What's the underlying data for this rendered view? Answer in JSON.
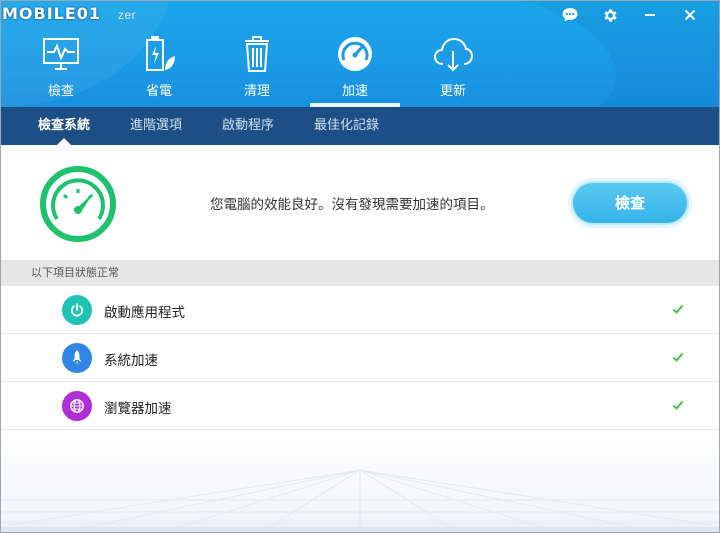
{
  "window": {
    "title": "zer",
    "watermark": "MOBILE01",
    "controls": [
      "feedback-icon",
      "gear-icon",
      "minimize-icon",
      "close-icon"
    ]
  },
  "main_nav": {
    "items": [
      {
        "label": "檢查",
        "icon": "monitor-pulse-icon",
        "active": false
      },
      {
        "label": "省電",
        "icon": "battery-leaf-icon",
        "active": false
      },
      {
        "label": "清理",
        "icon": "trash-can-icon",
        "active": false
      },
      {
        "label": "加速",
        "icon": "speedometer-icon",
        "active": true
      },
      {
        "label": "更新",
        "icon": "cloud-download-icon",
        "active": false
      }
    ]
  },
  "sub_nav": {
    "tabs": [
      {
        "label": "檢查系統",
        "active": true
      },
      {
        "label": "進階選項",
        "active": false
      },
      {
        "label": "啟動程序",
        "active": false
      },
      {
        "label": "最佳化記錄",
        "active": false
      }
    ]
  },
  "status": {
    "message": "您電腦的效能良好。沒有發現需要加速的項目。",
    "scan_button": "檢查",
    "gauge_icon": "speedometer-icon",
    "gauge_color": "#1fc26c"
  },
  "section": {
    "header": "以下項目狀態正常"
  },
  "items": [
    {
      "label": "啟動應用程式",
      "icon": "power-icon",
      "color": "#1dc4b4",
      "status": "ok"
    },
    {
      "label": "系統加速",
      "icon": "rocket-icon",
      "color": "#2f86e6",
      "status": "ok"
    },
    {
      "label": "瀏覽器加速",
      "icon": "globe-icon",
      "color": "#b02ed6",
      "status": "ok"
    }
  ],
  "colors": {
    "header": "#1b9be6",
    "sub_nav": "#1d4f86",
    "check": "#3cbf4a",
    "button": "#3cb8ec"
  }
}
